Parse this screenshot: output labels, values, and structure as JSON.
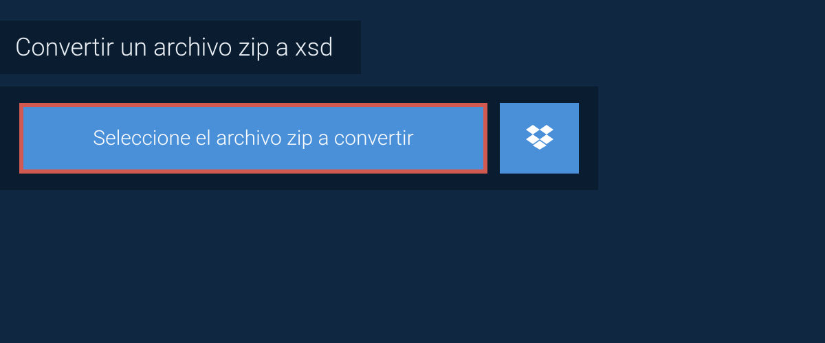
{
  "header": {
    "title": "Convertir un archivo zip a xsd"
  },
  "upload": {
    "select_button_label": "Seleccione el archivo zip a convertir",
    "dropbox_icon": "dropbox"
  },
  "colors": {
    "background": "#0f2740",
    "panel": "#0a1d30",
    "button": "#4a90d9",
    "highlight_border": "#d05a52",
    "text_light": "#e8eef4",
    "text_white": "#ffffff"
  }
}
